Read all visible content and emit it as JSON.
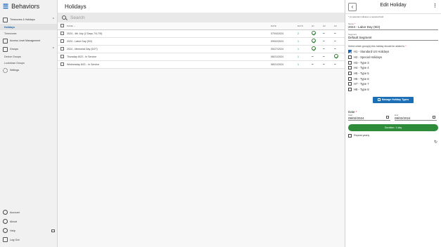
{
  "app": {
    "title": "Behaviors"
  },
  "sidebar": {
    "items": [
      {
        "label": "Timezones & Holidays"
      },
      {
        "label": "Holidays"
      },
      {
        "label": "Timezones"
      },
      {
        "label": "Access Level Management"
      },
      {
        "label": "Groups"
      },
      {
        "label": "Device Groups"
      },
      {
        "label": "Lockdown Groups"
      },
      {
        "label": "Settings"
      }
    ],
    "bottom": [
      {
        "label": "Account"
      },
      {
        "label": "About"
      },
      {
        "label": "Help"
      },
      {
        "label": "Log Out"
      }
    ]
  },
  "main": {
    "title": "Holidays",
    "search_placeholder": "Search",
    "columns": [
      "NAME",
      "DATE",
      "DAYS",
      "H1",
      "H2",
      "H3"
    ],
    "rows": [
      {
        "name": "2024 - 4th July (2 Days 7/4-7/5)",
        "date": "07/04/2024",
        "days": "2",
        "h1": "check",
        "h2": "–",
        "h3": "–"
      },
      {
        "name": "2024 - Labor Day (9/2)",
        "date": "09/02/2024",
        "days": "1",
        "h1": "check",
        "h2": "–",
        "h3": "–"
      },
      {
        "name": "2024 - Memorial Day (5/27)",
        "date": "05/27/2024",
        "days": "1",
        "h1": "check",
        "h2": "–",
        "h3": "–"
      },
      {
        "name": "Thursday 8/22 - In Service",
        "date": "08/21/2024",
        "days": "1",
        "h1": "–",
        "h2": "–",
        "h3": "check"
      },
      {
        "name": "Wednesday 8/21 - In Service",
        "date": "08/21/2024",
        "days": "1",
        "h1": "–",
        "h2": "–",
        "h3": "–"
      }
    ]
  },
  "panel": {
    "title": "Edit Holiday",
    "required_note": "An asterisk indicates a required field",
    "name_label": "Name",
    "name_value": "2024 - Labor Day (9/2)",
    "segment_label": "Segment",
    "segment_value": "Default Segment",
    "groups_prompt": "Select which group(s) this holiday should be added to",
    "groups": [
      {
        "label": "H1 - Standard US Holidays",
        "checked": true
      },
      {
        "label": "H2 - Special Holidays",
        "checked": false
      },
      {
        "label": "H3 - Type 3",
        "checked": false
      },
      {
        "label": "H4 - Type 4",
        "checked": false
      },
      {
        "label": "H5 - Type 5",
        "checked": false
      },
      {
        "label": "H6 - Type 6",
        "checked": false
      },
      {
        "label": "H7 - Type 7",
        "checked": false
      },
      {
        "label": "H8 - Type 8",
        "checked": false
      }
    ],
    "manage_button": "Manage Holiday Types",
    "date_label": "Date",
    "start_label": "Start",
    "start_value": "09/02/2024",
    "end_label": "End",
    "end_value": "09/02/2024",
    "duration_text": "Duration: 1 day",
    "repeat_label": "Repeat yearly"
  },
  "colors": {
    "accent": "#1565c0",
    "success": "#2e8b3a",
    "required": "#c62828"
  }
}
